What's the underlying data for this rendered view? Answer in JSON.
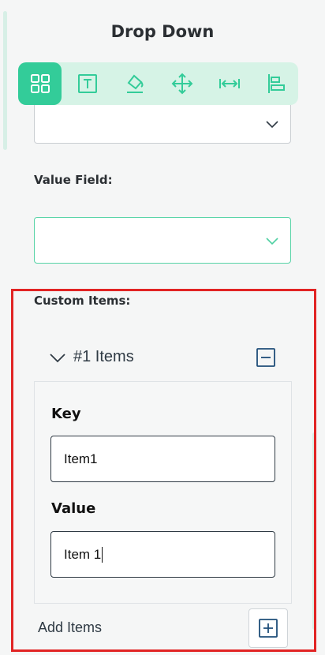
{
  "panel_title": "Drop Down",
  "toolbar": {
    "items": [
      {
        "icon": "grid-icon",
        "active": true
      },
      {
        "icon": "text-icon",
        "active": false
      },
      {
        "icon": "paint-bucket-icon",
        "active": false
      },
      {
        "icon": "move-icon",
        "active": false
      },
      {
        "icon": "width-icon",
        "active": false
      },
      {
        "icon": "align-left-icon",
        "active": false
      }
    ],
    "accent_color": "#33cc99",
    "background_color": "#d6f3e6"
  },
  "form": {
    "display_field_value": "",
    "value_field_label": "Value Field:",
    "value_field_value": "",
    "custom_items_label": "Custom Items:"
  },
  "items_group": {
    "title": "#1 Items",
    "key_label": "Key",
    "key_value": "Item1",
    "value_label": "Value",
    "value_value": "Item 1"
  },
  "add_items_label": "Add Items",
  "highlight_color": "#e12424"
}
